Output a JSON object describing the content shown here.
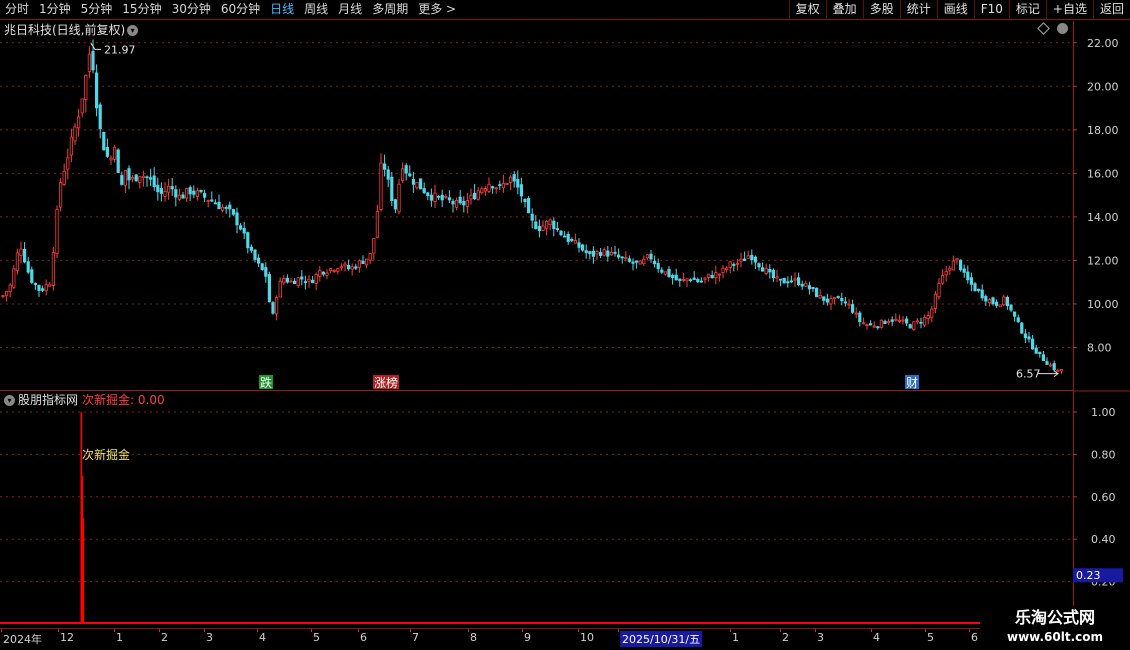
{
  "toolbar": {
    "periods": [
      "分时",
      "1分钟",
      "5分钟",
      "15分钟",
      "30分钟",
      "60分钟",
      "日线",
      "周线",
      "月线",
      "多周期",
      "更多 >"
    ],
    "active_period": "日线",
    "buttons": [
      "复权",
      "叠加",
      "多股",
      "统计",
      "画线",
      "F10",
      "标记",
      "+自选",
      "返回"
    ]
  },
  "price_panel": {
    "title": "兆日科技(日线,前复权)",
    "high_label": "21.97",
    "low_label": "6.57",
    "event_markers": [
      {
        "text": "跌",
        "color": "#1a9a2a"
      },
      {
        "text": "涨榜",
        "color": "#b02020"
      },
      {
        "text": "财",
        "color": "#2a6fbf"
      }
    ],
    "y_ticks": [
      "22.00",
      "20.00",
      "18.00",
      "16.00",
      "14.00",
      "12.00",
      "10.00",
      "8.00"
    ]
  },
  "indicator_panel": {
    "source_name": "股朋指标网",
    "indicator_label": "次新掘金: 0.00",
    "annotation": "次新掘金",
    "y_ticks": [
      "1.00",
      "0.80",
      "0.60",
      "0.40",
      "0.20"
    ],
    "current_value": "0.23"
  },
  "date_axis": {
    "labels": [
      "2024年",
      "12",
      "1",
      "2",
      "3",
      "4",
      "5",
      "6",
      "7",
      "8",
      "9",
      "10",
      "2025/10/31/五",
      "1",
      "2",
      "3",
      "4",
      "5",
      "6"
    ],
    "selected": "2025/10/31/五"
  },
  "watermark": {
    "line1": "乐淘公式网",
    "line2": "www.60lt.com"
  },
  "colors": {
    "up": "#ff3b3b",
    "down": "#4fd8e8",
    "grid": "#8a1a1a",
    "active_tab": "#47b9ff",
    "indicator_bar": "#ff0000"
  },
  "chart_data": {
    "type": "candlestick",
    "price_axis": {
      "ylim": [
        6.0,
        23.0
      ],
      "ticks": [
        8,
        10,
        12,
        14,
        16,
        18,
        20,
        22
      ]
    },
    "close_path": [
      [
        0,
        10.2
      ],
      [
        10,
        10.8
      ],
      [
        20,
        12.8
      ],
      [
        30,
        11.2
      ],
      [
        40,
        10.6
      ],
      [
        50,
        11.0
      ],
      [
        60,
        15.5
      ],
      [
        70,
        17.2
      ],
      [
        80,
        19.0
      ],
      [
        86,
        20.5
      ],
      [
        91,
        21.97
      ],
      [
        96,
        19.5
      ],
      [
        100,
        18.0
      ],
      [
        105,
        17.0
      ],
      [
        110,
        16.5
      ],
      [
        115,
        17.5
      ],
      [
        120,
        15.0
      ],
      [
        125,
        16.2
      ],
      [
        130,
        15.6
      ],
      [
        140,
        16.0
      ],
      [
        150,
        15.7
      ],
      [
        160,
        15.0
      ],
      [
        170,
        15.4
      ],
      [
        180,
        14.9
      ],
      [
        190,
        15.2
      ],
      [
        200,
        15.0
      ],
      [
        210,
        14.8
      ],
      [
        220,
        14.5
      ],
      [
        230,
        14.2
      ],
      [
        240,
        13.6
      ],
      [
        250,
        12.4
      ],
      [
        258,
        11.8
      ],
      [
        266,
        11.3
      ],
      [
        272,
        9.2
      ],
      [
        278,
        10.8
      ],
      [
        284,
        11.2
      ],
      [
        290,
        11.0
      ],
      [
        300,
        11.2
      ],
      [
        310,
        11.0
      ],
      [
        320,
        11.5
      ],
      [
        330,
        11.6
      ],
      [
        340,
        11.8
      ],
      [
        350,
        11.6
      ],
      [
        360,
        11.9
      ],
      [
        370,
        12.2
      ],
      [
        376,
        13.5
      ],
      [
        382,
        16.8
      ],
      [
        388,
        15.6
      ],
      [
        395,
        14.3
      ],
      [
        402,
        16.5
      ],
      [
        410,
        15.8
      ],
      [
        420,
        15.4
      ],
      [
        430,
        15.0
      ],
      [
        440,
        14.8
      ],
      [
        450,
        14.7
      ],
      [
        460,
        14.5
      ],
      [
        470,
        14.8
      ],
      [
        480,
        15.3
      ],
      [
        490,
        15.6
      ],
      [
        500,
        15.3
      ],
      [
        510,
        15.8
      ],
      [
        520,
        15.2
      ],
      [
        530,
        13.8
      ],
      [
        540,
        13.5
      ],
      [
        550,
        13.8
      ],
      [
        560,
        13.3
      ],
      [
        570,
        12.9
      ],
      [
        580,
        12.6
      ],
      [
        590,
        12.2
      ],
      [
        600,
        12.4
      ],
      [
        610,
        12.3
      ],
      [
        620,
        12.1
      ],
      [
        630,
        11.9
      ],
      [
        640,
        11.8
      ],
      [
        650,
        12.2
      ],
      [
        660,
        11.6
      ],
      [
        670,
        11.3
      ],
      [
        680,
        11.0
      ],
      [
        690,
        11.2
      ],
      [
        700,
        11.0
      ],
      [
        710,
        11.3
      ],
      [
        720,
        11.4
      ],
      [
        730,
        11.8
      ],
      [
        740,
        11.9
      ],
      [
        750,
        12.3
      ],
      [
        760,
        11.8
      ],
      [
        770,
        11.3
      ],
      [
        780,
        11.0
      ],
      [
        790,
        11.1
      ],
      [
        800,
        11.0
      ],
      [
        810,
        10.7
      ],
      [
        820,
        10.3
      ],
      [
        830,
        10.1
      ],
      [
        840,
        10.2
      ],
      [
        850,
        9.9
      ],
      [
        860,
        9.2
      ],
      [
        870,
        9.0
      ],
      [
        880,
        9.1
      ],
      [
        890,
        9.3
      ],
      [
        900,
        9.2
      ],
      [
        910,
        9.0
      ],
      [
        920,
        9.2
      ],
      [
        930,
        9.5
      ],
      [
        940,
        11.0
      ],
      [
        950,
        11.8
      ],
      [
        958,
        12.0
      ],
      [
        965,
        11.2
      ],
      [
        975,
        10.7
      ],
      [
        985,
        10.3
      ],
      [
        995,
        10.0
      ],
      [
        1005,
        10.2
      ],
      [
        1012,
        9.6
      ],
      [
        1020,
        8.9
      ],
      [
        1030,
        8.2
      ],
      [
        1040,
        7.6
      ],
      [
        1050,
        7.2
      ],
      [
        1058,
        6.9
      ],
      [
        1062,
        7.0
      ]
    ],
    "indicator": {
      "ylim": [
        0.0,
        1.0
      ],
      "ticks": [
        0.2,
        0.4,
        0.6,
        0.8,
        1.0
      ],
      "bars": [
        {
          "date_pos": 81,
          "value": 1.0
        },
        {
          "date_pos": 82,
          "value": 0.7
        },
        {
          "date_pos": 83,
          "value": 0.5
        }
      ]
    }
  }
}
